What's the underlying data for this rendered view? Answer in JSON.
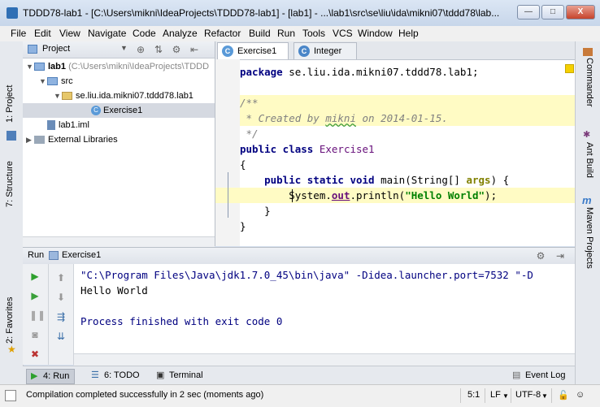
{
  "window": {
    "title": "TDDD78-lab1 - [C:\\Users\\mikni\\IdeaProjects\\TDDD78-lab1] - [lab1] - ...\\lab1\\src\\se\\liu\\ida\\mikni07\\tddd78\\lab...",
    "min_glyph": "—",
    "max_glyph": "□",
    "close_glyph": "X"
  },
  "menu": [
    "File",
    "Edit",
    "View",
    "Navigate",
    "Code",
    "Analyze",
    "Refactor",
    "Build",
    "Run",
    "Tools",
    "VCS",
    "Window",
    "Help"
  ],
  "left_strip": {
    "project_tab": "1: Project",
    "structure_tab": "7: Structure",
    "favorites_tab": "2: Favorites"
  },
  "right_strip": {
    "commander_tab": "Commander",
    "ant_tab": "Ant Build",
    "maven_tab": "Maven Projects"
  },
  "project": {
    "dropdown": "Project",
    "tree": {
      "root_name": "lab1",
      "root_path": "(C:\\Users\\mikni\\IdeaProjects\\TDDD",
      "src": "src",
      "package": "se.liu.ida.mikni07.tddd78.lab1",
      "class": "Exercise1",
      "iml": "lab1.iml",
      "libs": "External Libraries"
    }
  },
  "editor": {
    "tabs": [
      {
        "label": "Exercise1",
        "icon": "class-icon"
      },
      {
        "label": "Integer",
        "icon": "class-icon"
      }
    ],
    "lines": {
      "l1_kw": "package",
      "l1_rest": " se.liu.ida.mikni07.tddd78.lab1;",
      "l2": "/**",
      "l3_a": " * Created by ",
      "l3_user": "mikni",
      "l3_b": " on 2014-01-15.",
      "l4": " */",
      "l5_kw": "public class",
      "l5_name": " Exercise1",
      "l6": "{",
      "l7_kw": "    public static void",
      "l7_mid": " main(String[] ",
      "l7_arg": "args",
      "l7_end": ") {",
      "l8_pre": "        System.",
      "l8_out": "out",
      "l8_mid": ".println(",
      "l8_str": "\"Hello World\"",
      "l8_end": ");",
      "l9": "    }",
      "l10": "}"
    }
  },
  "run": {
    "label": "Run",
    "config": "Exercise1",
    "console": {
      "cmd": "\"C:\\Program Files\\Java\\jdk1.7.0_45\\bin\\java\" -Didea.launcher.port=7532 \"-D",
      "output": "Hello World",
      "finished": "Process finished with exit code 0"
    }
  },
  "bottom_tabs": {
    "run": "4: Run",
    "todo": "6: TODO",
    "terminal": "Terminal",
    "eventlog": "Event Log"
  },
  "status": {
    "message": "Compilation completed successfully in 2 sec (moments ago)",
    "position": "5:1",
    "line_sep": "LF",
    "encoding": "UTF-8"
  }
}
